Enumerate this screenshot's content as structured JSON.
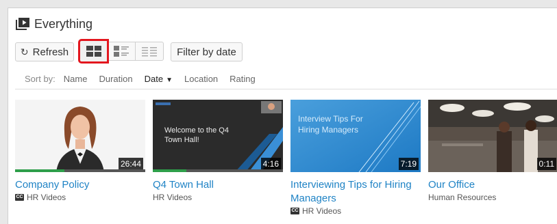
{
  "header": {
    "title": "Everything"
  },
  "toolbar": {
    "refresh_label": "Refresh",
    "filter_label": "Filter by date"
  },
  "sort": {
    "label": "Sort by:",
    "options": [
      "Name",
      "Duration",
      "Date",
      "Location",
      "Rating"
    ],
    "active": "Date",
    "active_indicator": "▼"
  },
  "videos": [
    {
      "title": "Company Policy",
      "channel": "HR Videos",
      "duration": "26:44",
      "has_cc": true,
      "watched_fraction": 0.38,
      "overlay_text": ""
    },
    {
      "title": "Q4 Town Hall",
      "channel": "HR Videos",
      "duration": "4:16",
      "has_cc": false,
      "watched_fraction": 0.26,
      "overlay_text": "Welcome to the Q4 Town Hall!"
    },
    {
      "title": "Interviewing Tips for Hiring Managers",
      "channel": "HR Videos",
      "duration": "7:19",
      "has_cc": true,
      "watched_fraction": 0,
      "overlay_text": "Interview Tips For Hiring Managers"
    },
    {
      "title": "Our Office",
      "channel": "Human Resources",
      "duration": "0:11",
      "has_cc": false,
      "watched_fraction": 0,
      "overlay_text": ""
    }
  ],
  "colors": {
    "accent": "#1f83c5",
    "selected_outline": "#e3161e",
    "progress": "#2e9e4a"
  }
}
